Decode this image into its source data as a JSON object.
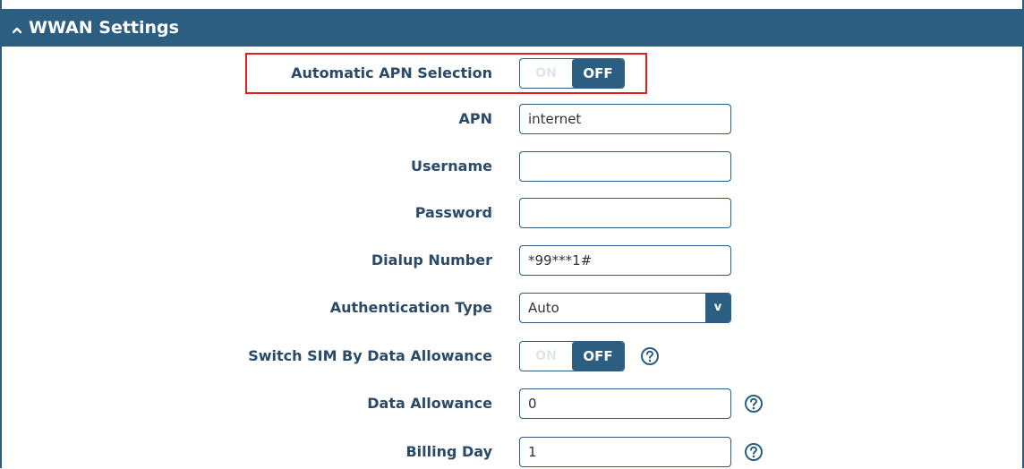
{
  "section": {
    "title": "WWAN Settings"
  },
  "fields": {
    "auto_apn": {
      "label": "Automatic APN Selection",
      "on_label": "ON",
      "off_label": "OFF",
      "state": "OFF"
    },
    "apn": {
      "label": "APN",
      "value": "internet"
    },
    "username": {
      "label": "Username",
      "value": ""
    },
    "password": {
      "label": "Password",
      "value": ""
    },
    "dialup": {
      "label": "Dialup Number",
      "value": "*99***1#"
    },
    "auth_type": {
      "label": "Authentication Type",
      "value": "Auto",
      "arrow": "v"
    },
    "switch_sim": {
      "label": "Switch SIM By Data Allowance",
      "on_label": "ON",
      "off_label": "OFF",
      "state": "OFF"
    },
    "data_allowance": {
      "label": "Data Allowance",
      "value": "0"
    },
    "billing_day": {
      "label": "Billing Day",
      "value": "1"
    }
  },
  "colors": {
    "header_bg": "#2c5e81",
    "label_text": "#2a4a68",
    "highlight_border": "#e02020"
  },
  "icons": {
    "collapse": "chevron-up-icon",
    "help": "help-circle-icon"
  }
}
